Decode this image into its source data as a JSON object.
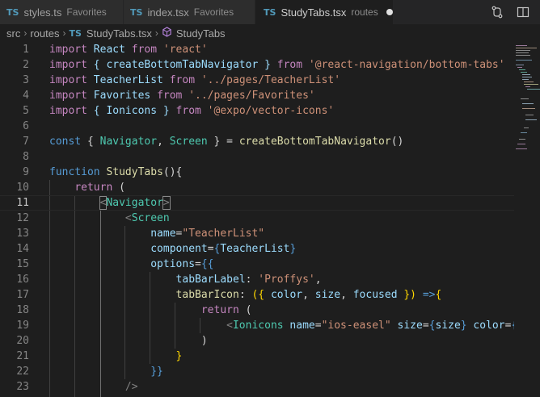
{
  "tabs": [
    {
      "lang": "TS",
      "name": "styles.ts",
      "desc": "Favorites"
    },
    {
      "lang": "TS",
      "name": "index.tsx",
      "desc": "Favorites"
    },
    {
      "lang": "TS",
      "name": "StudyTabs.tsx",
      "desc": "routes"
    }
  ],
  "toolbar": {
    "icons": [
      "source-control-compare-icon",
      "split-editor-icon"
    ]
  },
  "breadcrumb": {
    "folder1": "src",
    "folder2": "routes",
    "file": "StudyTabs.tsx",
    "symbol": "StudyTabs"
  },
  "code": {
    "l1": [
      "import",
      " React ",
      "from",
      " 'react'"
    ],
    "l2": [
      "import",
      " { createBottomTabNavigator } ",
      "from",
      " '@react-navigation/bottom-tabs'"
    ],
    "l3": [
      "import",
      " TeacherList ",
      "from",
      " '../pages/TeacherList'"
    ],
    "l4": [
      "import",
      " Favorites ",
      "from",
      " '../pages/Favorites'"
    ],
    "l5": [
      "import",
      " { Ionicons } ",
      "from",
      " '@expo/vector-icons'"
    ],
    "l7": [
      "const",
      " { ",
      "Navigator",
      ", ",
      "Screen",
      " } = ",
      "createBottomTabNavigator",
      "()"
    ],
    "l9": [
      "function",
      " ",
      "StudyTabs",
      "(){"
    ],
    "l10": [
      "return",
      " ("
    ],
    "l11": [
      "<",
      "Navigator",
      ">"
    ],
    "l12": [
      "<",
      "Screen"
    ],
    "l13": [
      "name",
      "=",
      "\"TeacherList\""
    ],
    "l14": [
      "component",
      "=",
      "{",
      "TeacherList",
      "}"
    ],
    "l15": [
      "options",
      "=",
      "{{"
    ],
    "l16": [
      "tabBarLabel",
      ": ",
      "'Proffys'",
      ","
    ],
    "l17": [
      "tabBarIcon",
      ": ",
      "({",
      " color",
      ",",
      " size",
      ",",
      " focused",
      " })",
      " =>",
      "{"
    ],
    "l18": [
      "return",
      " ("
    ],
    "l19": [
      "<",
      "Ionicons",
      " name",
      "=",
      "\"ios-easel\"",
      " size",
      "=",
      "{",
      "size",
      "}",
      " color",
      "=",
      "{t"
    ],
    "l20": [
      ")"
    ],
    "l21": [
      "}"
    ],
    "l22": [
      "}}"
    ],
    "l23": [
      "/>"
    ]
  },
  "line_numbers": [
    "1",
    "2",
    "3",
    "4",
    "5",
    "6",
    "7",
    "8",
    "9",
    "10",
    "11",
    "12",
    "13",
    "14",
    "15",
    "16",
    "17",
    "18",
    "19",
    "20",
    "21",
    "22",
    "23"
  ]
}
